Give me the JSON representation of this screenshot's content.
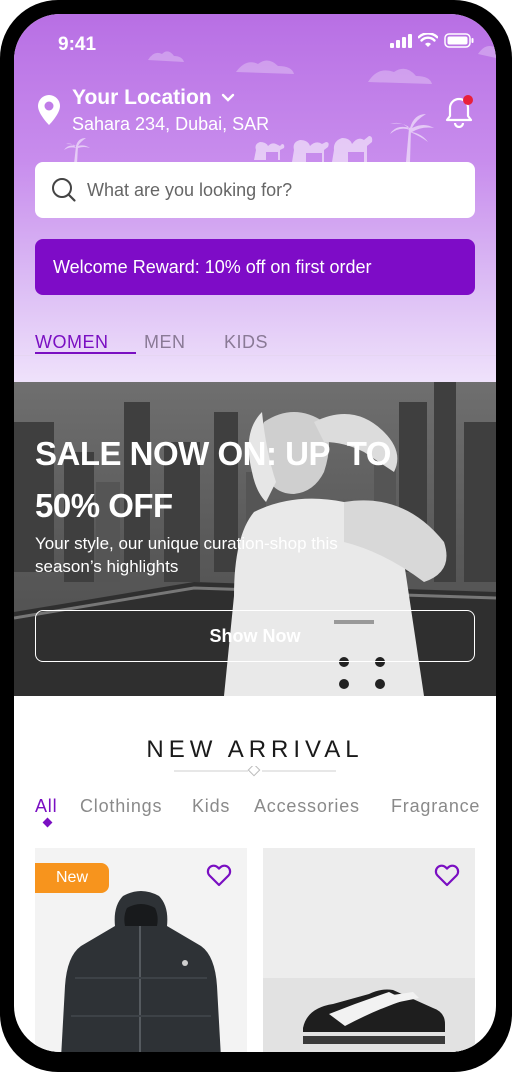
{
  "status_bar": {
    "time": "9:41"
  },
  "location": {
    "title": "Your Location",
    "address": "Sahara 234, Dubai, SAR"
  },
  "search": {
    "placeholder": "What are you looking for?"
  },
  "reward_banner": {
    "text": "Welcome Reward: 10% off on first order"
  },
  "gender_tabs": [
    {
      "label": "WOMEN",
      "active": true
    },
    {
      "label": "MEN",
      "active": false
    },
    {
      "label": "KIDS",
      "active": false
    }
  ],
  "hero": {
    "title_line1": "SALE NOW ON: UP  TO",
    "title_line2": "50% OFF",
    "subtitle": "Your style, our unique curation-shop this season’s highlights",
    "button_label": "Show Now"
  },
  "new_arrival": {
    "title": "NEW ARRIVAL",
    "filters": [
      {
        "label": "All",
        "active": true
      },
      {
        "label": "Clothings",
        "active": false
      },
      {
        "label": "Kids",
        "active": false
      },
      {
        "label": "Accessories",
        "active": false
      },
      {
        "label": "Fragrance",
        "active": false
      }
    ]
  },
  "products": [
    {
      "badge": "New",
      "image": "black-puffer-jacket",
      "favorite_icon": "heart-outline-icon"
    },
    {
      "badge": "",
      "image": "black-white-sneaker",
      "favorite_icon": "heart-outline-icon"
    }
  ],
  "colors": {
    "accent": "#7a0fc2",
    "reward_bg": "#7e0cc7",
    "badge": "#f7941d",
    "header_gradient_top": "#b86fe4",
    "header_gradient_bottom": "#efe2fb"
  }
}
